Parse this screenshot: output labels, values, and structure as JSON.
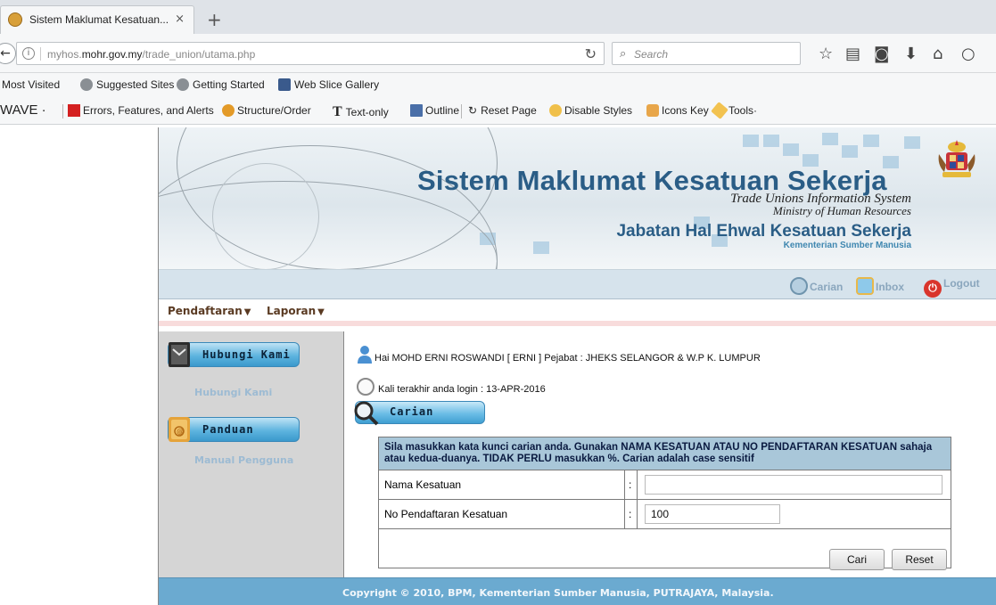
{
  "browser": {
    "tab_title": "Sistem Maklumat Kesatuan...",
    "tab_close": "×",
    "new_tab": "+",
    "url_prefix": "myhos.",
    "url_host": "mohr.gov.my",
    "url_path": "/trade_union/utama.php",
    "search_placeholder": "Search"
  },
  "bookmarks": [
    "Most Visited",
    "Suggested Sites",
    "Getting Started",
    "Web Slice Gallery"
  ],
  "wave_toolbar": {
    "label": "WAVE ·",
    "items": [
      "Errors, Features, and Alerts",
      "Structure/Order",
      "Text-only",
      "Outline",
      "Reset Page",
      "Disable Styles",
      "Icons Key",
      "Tools·"
    ]
  },
  "banner": {
    "title": "Sistem Maklumat Kesatuan Sekerja",
    "subtitle_en": "Trade Unions Information System",
    "ministry_en": "Ministry of Human Resources",
    "department": "Jabatan Hal Ehwal Kesatuan Sekerja",
    "ministry_ms": "Kementerian Sumber Manusia"
  },
  "toolbar": {
    "carian": "Carian",
    "inbox": "Inbox",
    "logout": "Logout"
  },
  "menu": [
    "Pendaftaran",
    "Laporan"
  ],
  "sidebar": {
    "contact_btn": "Hubungi Kami",
    "contact_link": "Hubungi Kami",
    "guide_btn": "Panduan",
    "guide_link": "Manual Pengguna"
  },
  "main": {
    "greeting": "Hai MOHD ERNI ROSWANDI [ ERNI ] Pejabat : JHEKS SELANGOR & W.P K. LUMPUR",
    "last_login": "Kali terakhir anda login : 13-APR-2016",
    "search_tab": "Carian",
    "instructions": "Sila masukkan kata kunci carian anda. Gunakan NAMA KESATUAN ATAU NO PENDAFTARAN KESATUAN sahaja atau kedua-duanya. TIDAK PERLU masukkan %. Carian adalah case sensitif",
    "field_name_label": "Nama Kesatuan",
    "field_name_value": "",
    "field_reg_label": "No Pendaftaran Kesatuan",
    "field_reg_value": "100",
    "colon": ":",
    "btn_search": "Cari",
    "btn_reset": "Reset"
  },
  "footer": {
    "copyright": "Copyright © 2010, BPM, Kementerian Sumber Manusia, PUTRAJAYA, Malaysia."
  }
}
